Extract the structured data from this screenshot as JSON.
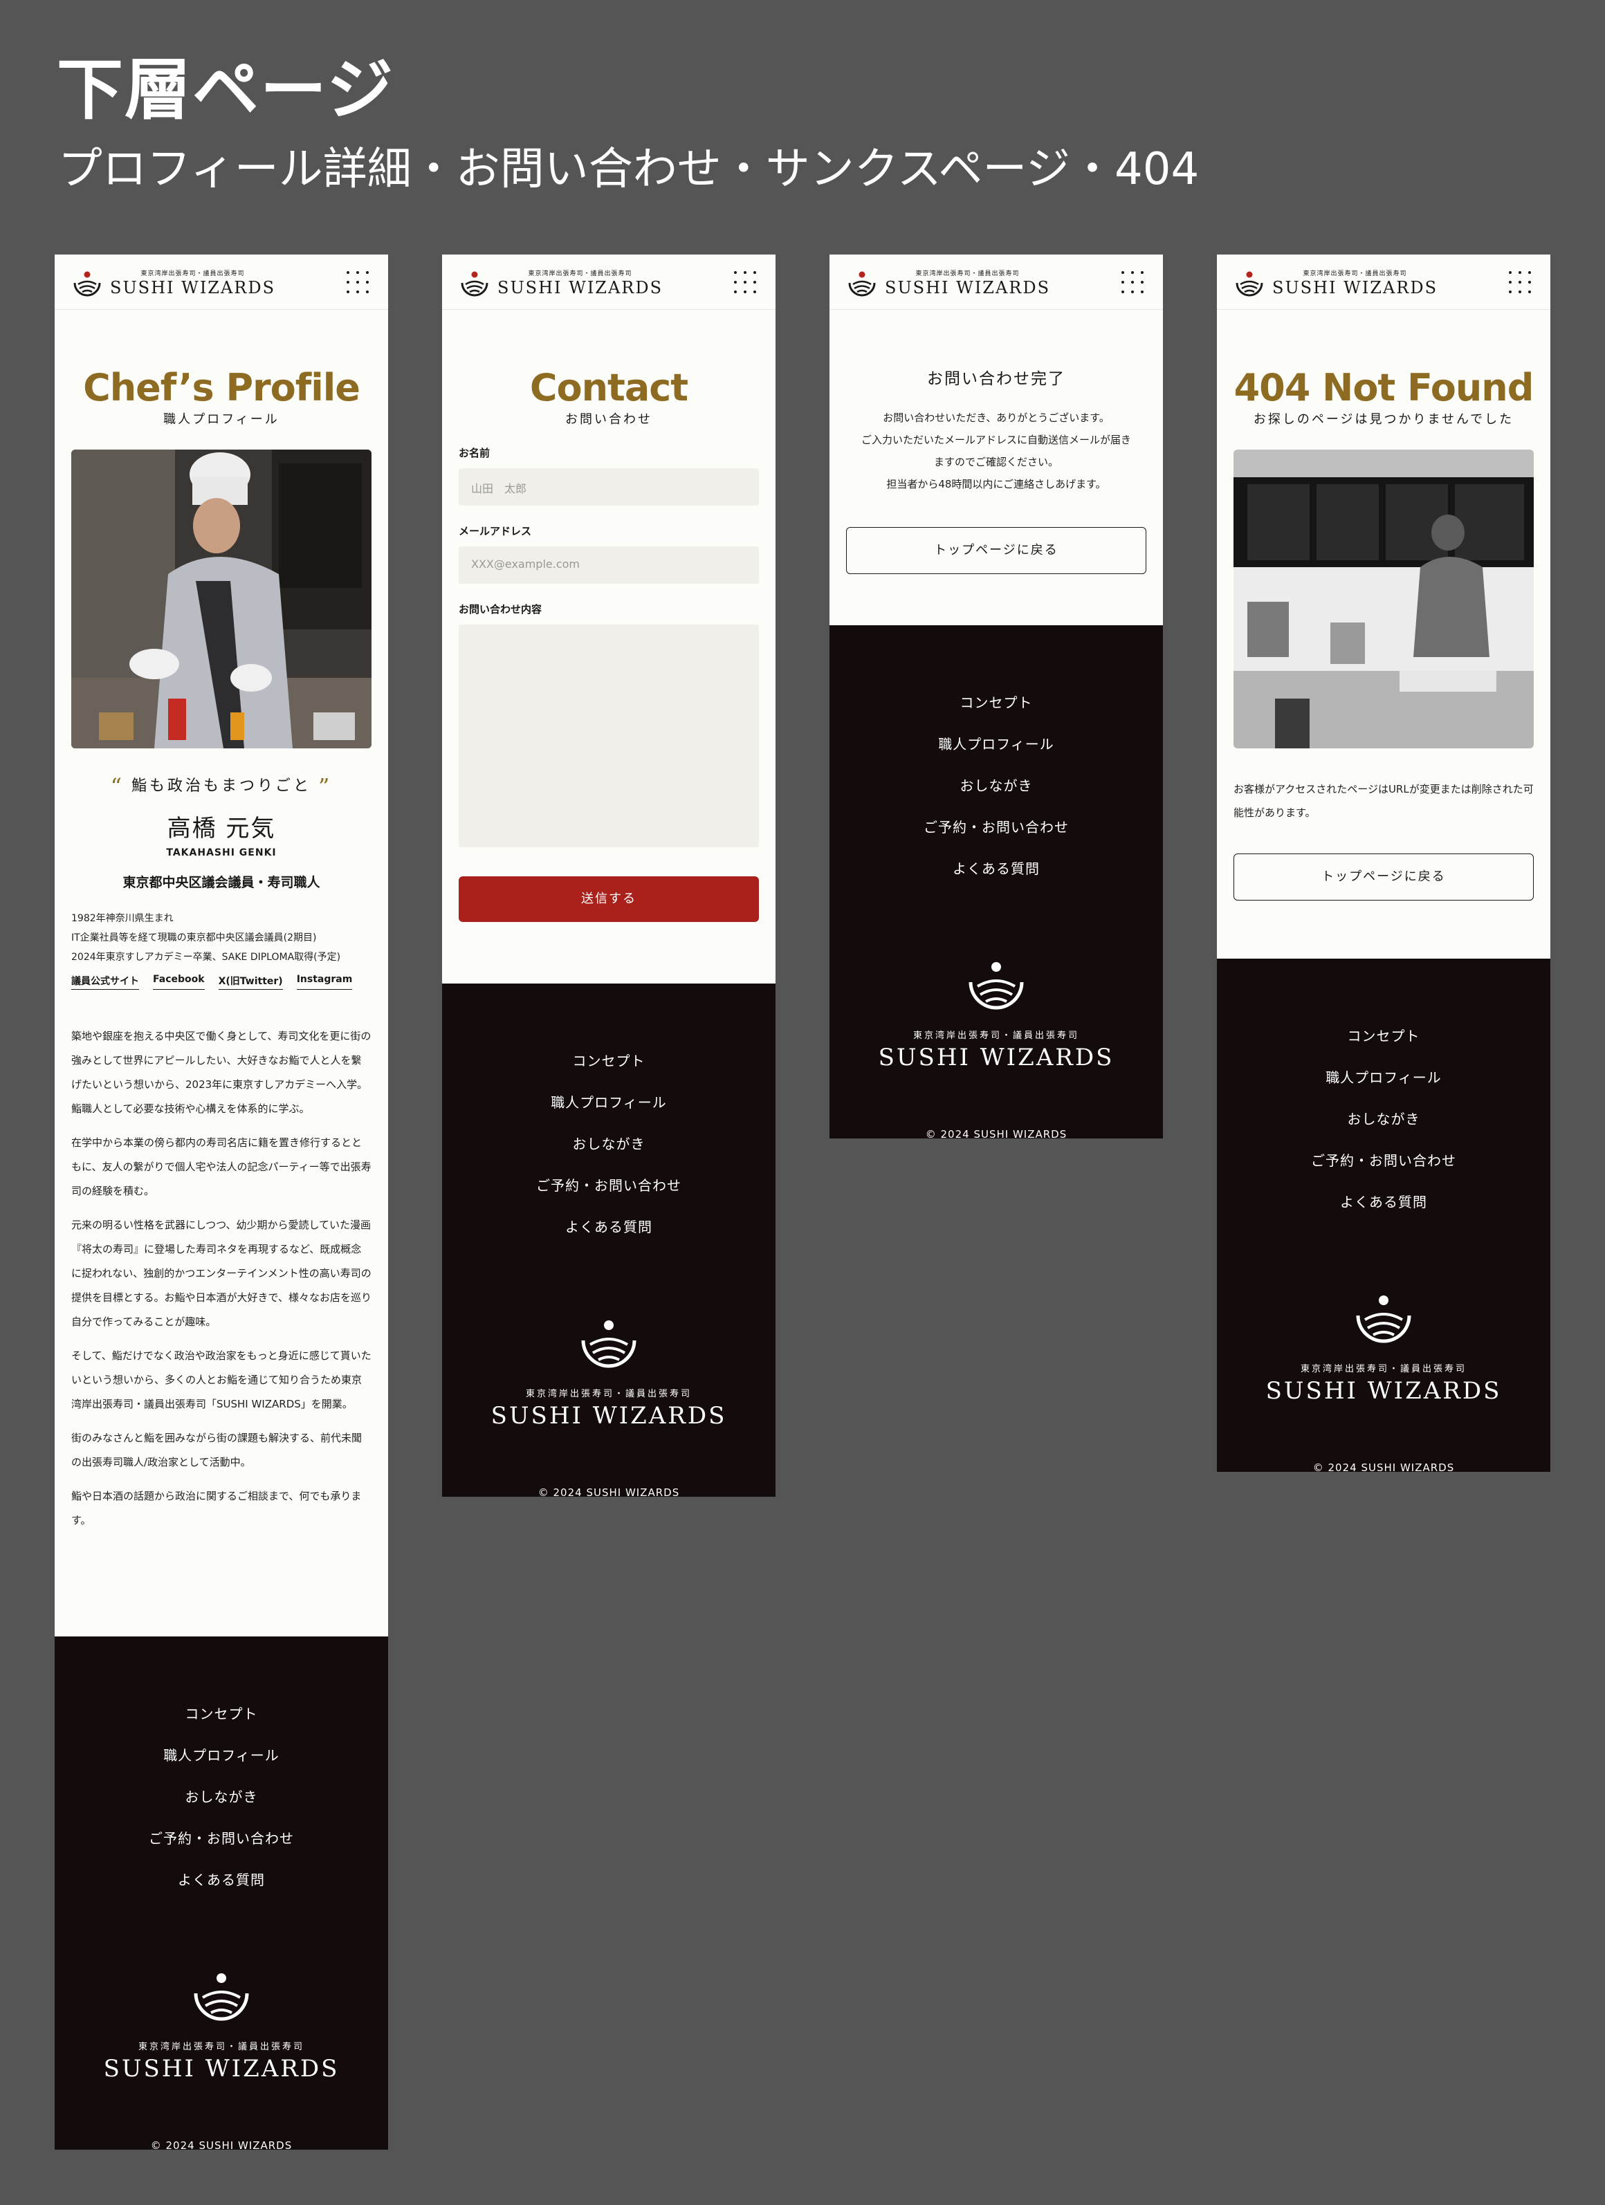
{
  "header": {
    "title": "下層ページ",
    "subtitle": "プロフィール詳細・お問い合わせ・サンクスページ・404"
  },
  "site": {
    "logo_small": "東京湾岸出張寿司・議員出張寿司",
    "logo_big": "SUSHI WIZARDS",
    "footer_small": "東京湾岸出張寿司・議員出張寿司",
    "footer_big": "SUSHI WIZARDS",
    "copyright": "© 2024 SUSHI WIZARDS",
    "nav": [
      "コンセプト",
      "職人プロフィール",
      "おしながき",
      "ご予約・お問い合わせ",
      "よくある質問"
    ]
  },
  "profile": {
    "title": "Chef’s Profile",
    "subtitle": "職人プロフィール",
    "quote": "鮨も政治もまつりごと",
    "quote_open": "“",
    "quote_close": "”",
    "name_jp": "高橋 元気",
    "name_en": "TAKAHASHI GENKI",
    "role": "東京都中央区議会議員・寿司職人",
    "bio": [
      "1982年神奈川県生まれ",
      "IT企業社員等を経て現職の東京都中央区議会議員(2期目)",
      "2024年東京すしアカデミー卒業、SAKE DIPLOMA取得(予定)"
    ],
    "links": [
      "議員公式サイト",
      "Facebook",
      "X(旧Twitter)",
      "Instagram"
    ],
    "paragraphs": [
      "築地や銀座を抱える中央区で働く身として、寿司文化を更に街の強みとして世界にアピールしたい、大好きなお鮨で人と人を繋げたいという想いから、2023年に東京すしアカデミーへ入学。鮨職人として必要な技術や心構えを体系的に学ぶ。",
      "在学中から本業の傍ら都内の寿司名店に籍を置き修行するとともに、友人の繋がりで個人宅や法人の記念パーティー等で出張寿司の経験を積む。",
      "元来の明るい性格を武器にしつつ、幼少期から愛読していた漫画『将太の寿司』に登場した寿司ネタを再現するなど、既成概念に捉われない、独創的かつエンターテインメント性の高い寿司の提供を目標とする。お鮨や日本酒が大好きで、様々なお店を巡り自分で作ってみることが趣味。",
      "そして、鮨だけでなく政治や政治家をもっと身近に感じて貰いたいという想いから、多くの人とお鮨を通じて知り合うため東京湾岸出張寿司・議員出張寿司「SUSHI WIZARDS」を開業。",
      "街のみなさんと鮨を囲みながら街の課題も解決する、前代未聞の出張寿司職人/政治家として活動中。",
      "鮨や日本酒の話題から政治に関するご相談まで、何でも承ります。"
    ]
  },
  "contact": {
    "title": "Contact",
    "subtitle": "お問い合わせ",
    "name_label": "お名前",
    "name_placeholder": "山田　太郎",
    "email_label": "メールアドレス",
    "email_placeholder": "XXX@example.com",
    "message_label": "お問い合わせ内容",
    "message_placeholder": "",
    "submit": "送信する"
  },
  "thanks": {
    "title": "お問い合わせ完了",
    "lines": [
      "お問い合わせいただき、ありがとうございます。",
      "ご入力いただいたメールアドレスに自動送信メールが届き",
      "ますのでご確認ください。",
      "担当者から48時間以内にご連絡さしあげます。"
    ],
    "back": "トップページに戻る"
  },
  "notfound": {
    "title": "404 Not Found",
    "subtitle": "お探しのページは見つかりませんでした",
    "message": "お客様がアクセスされたページはURLが変更または削除された可能性があります。",
    "back": "トップページに戻る"
  }
}
